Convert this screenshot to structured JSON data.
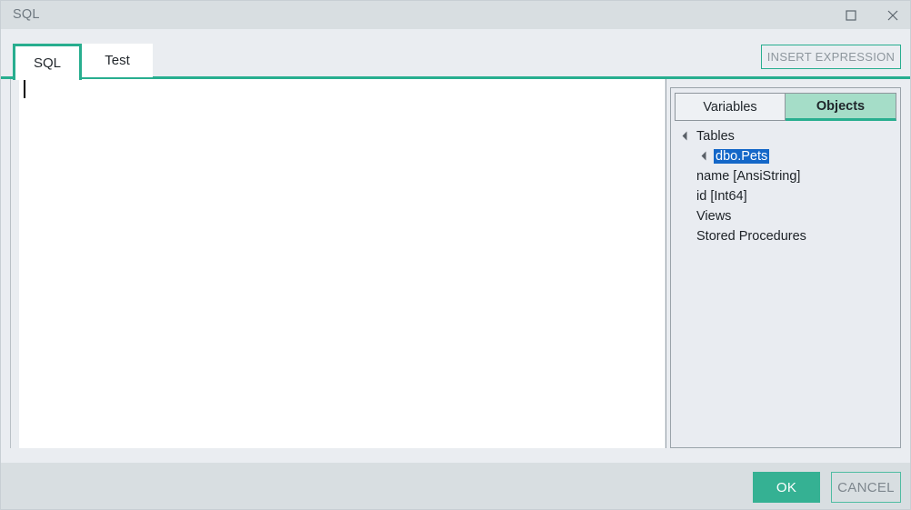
{
  "window": {
    "title": "SQL",
    "controls": [
      {
        "name": "maximize-button",
        "icon": "maximize-icon"
      },
      {
        "name": "close-button",
        "icon": "close-icon"
      }
    ]
  },
  "tabs": {
    "items": [
      {
        "label": "SQL",
        "active": true
      },
      {
        "label": "Test",
        "active": false
      }
    ]
  },
  "toolbar": {
    "insert_expression_label": "INSERT EXPRESSION"
  },
  "editor": {
    "content": "",
    "caret_visible": true
  },
  "right_panel": {
    "tabs": [
      {
        "label": "Variables",
        "active": false
      },
      {
        "label": "Objects",
        "active": true
      }
    ],
    "tree": [
      {
        "label": "Tables",
        "level": 0,
        "expanded": true,
        "has_arrow": true,
        "selected": false
      },
      {
        "label": "dbo.Pets",
        "level": 1,
        "expanded": true,
        "has_arrow": true,
        "selected": true
      },
      {
        "label": "name [AnsiString]",
        "level": 2,
        "expanded": false,
        "has_arrow": false,
        "selected": false
      },
      {
        "label": "id [Int64]",
        "level": 2,
        "expanded": false,
        "has_arrow": false,
        "selected": false
      },
      {
        "label": "Views",
        "level": 0,
        "expanded": false,
        "has_arrow": false,
        "selected": false
      },
      {
        "label": "Stored Procedures",
        "level": 0,
        "expanded": false,
        "has_arrow": false,
        "selected": false
      }
    ]
  },
  "footer": {
    "ok_label": "OK",
    "cancel_label": "CANCEL"
  },
  "colors": {
    "accent_teal": "#28ae8f",
    "ok_button": "#35b193",
    "tab_active_bg": "#a5ddc8",
    "selection_blue": "#1467c8",
    "chrome_gray": "#d8dee1",
    "panel_bg": "#e9ecf1"
  }
}
